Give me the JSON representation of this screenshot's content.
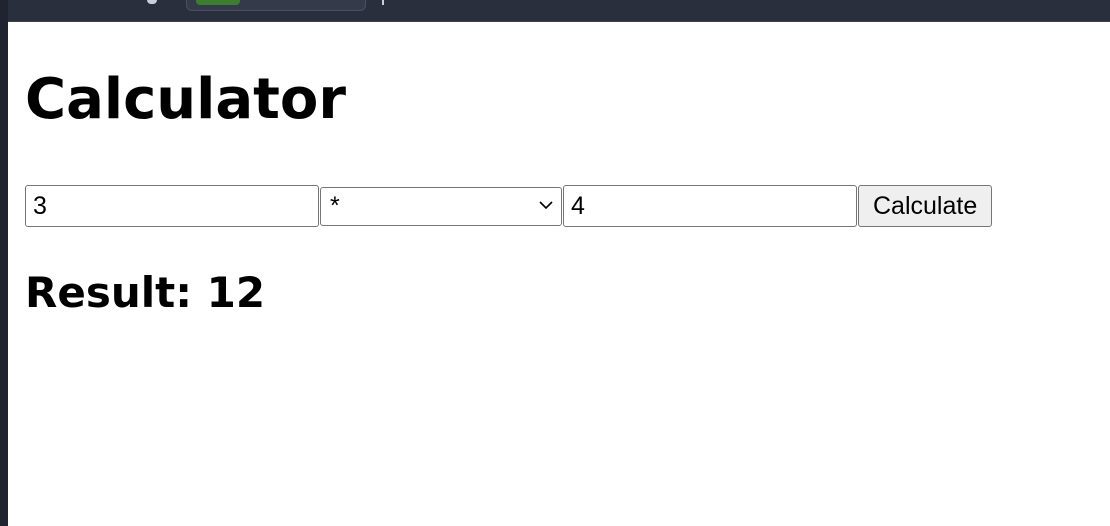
{
  "page": {
    "title": "Calculator"
  },
  "form": {
    "operand1": "3",
    "operator": "*",
    "operand2": "4",
    "submit_label": "Calculate"
  },
  "result": {
    "label": "Result: 12"
  },
  "icons": {
    "select_arrow": "chevron-down-icon"
  },
  "colors": {
    "browser_chrome": "#2a2f3d",
    "button_bg": "#efefef",
    "border": "#767676"
  }
}
